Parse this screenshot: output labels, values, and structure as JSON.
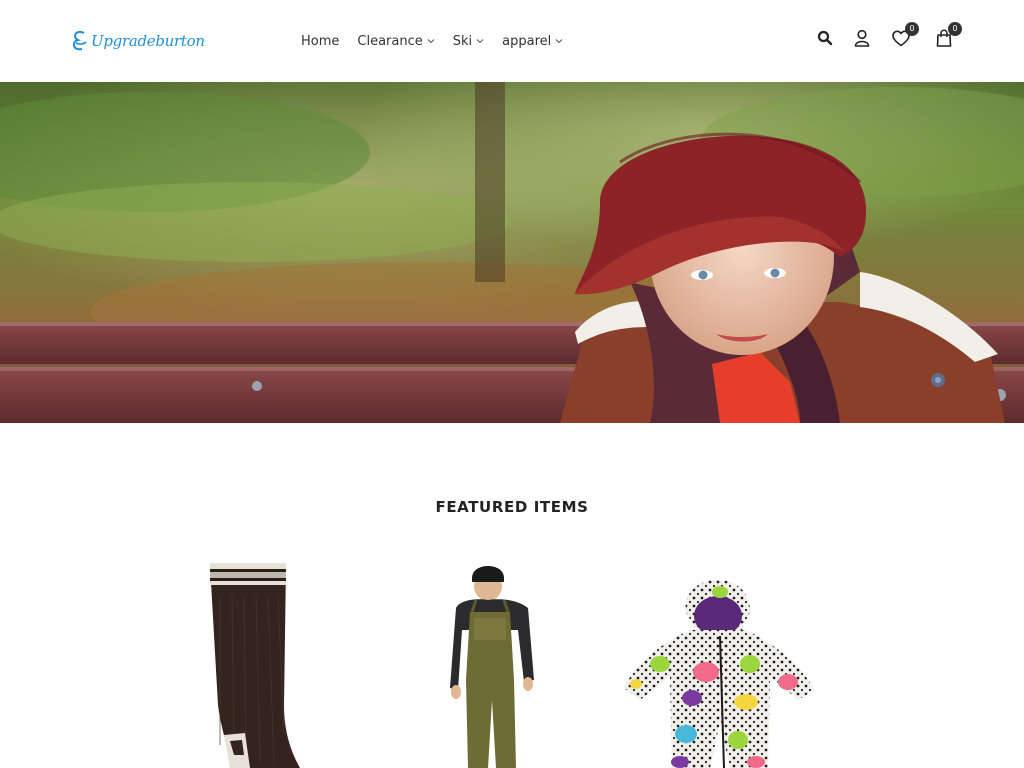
{
  "brand": {
    "logo_text": "Upgradeburton",
    "accent_color": "#1f8fd6"
  },
  "nav": {
    "items": [
      {
        "label": "Home",
        "has_dropdown": false
      },
      {
        "label": "Clearance",
        "has_dropdown": true
      },
      {
        "label": "Ski",
        "has_dropdown": true
      },
      {
        "label": "apparel",
        "has_dropdown": true
      }
    ]
  },
  "header_icons": {
    "search": "search-icon",
    "account": "user-icon",
    "wishlist": "heart-icon",
    "wishlist_count": "0",
    "cart": "shopping-bag-icon",
    "cart_count": "0"
  },
  "hero": {
    "image": "child-on-bench-banner"
  },
  "featured": {
    "title": "FEATURED ITEMS",
    "products": [
      {
        "image": "ski-sock"
      },
      {
        "image": "man-in-olive-bib-pants"
      },
      {
        "image": "kids-printed-snowsuit"
      }
    ]
  }
}
